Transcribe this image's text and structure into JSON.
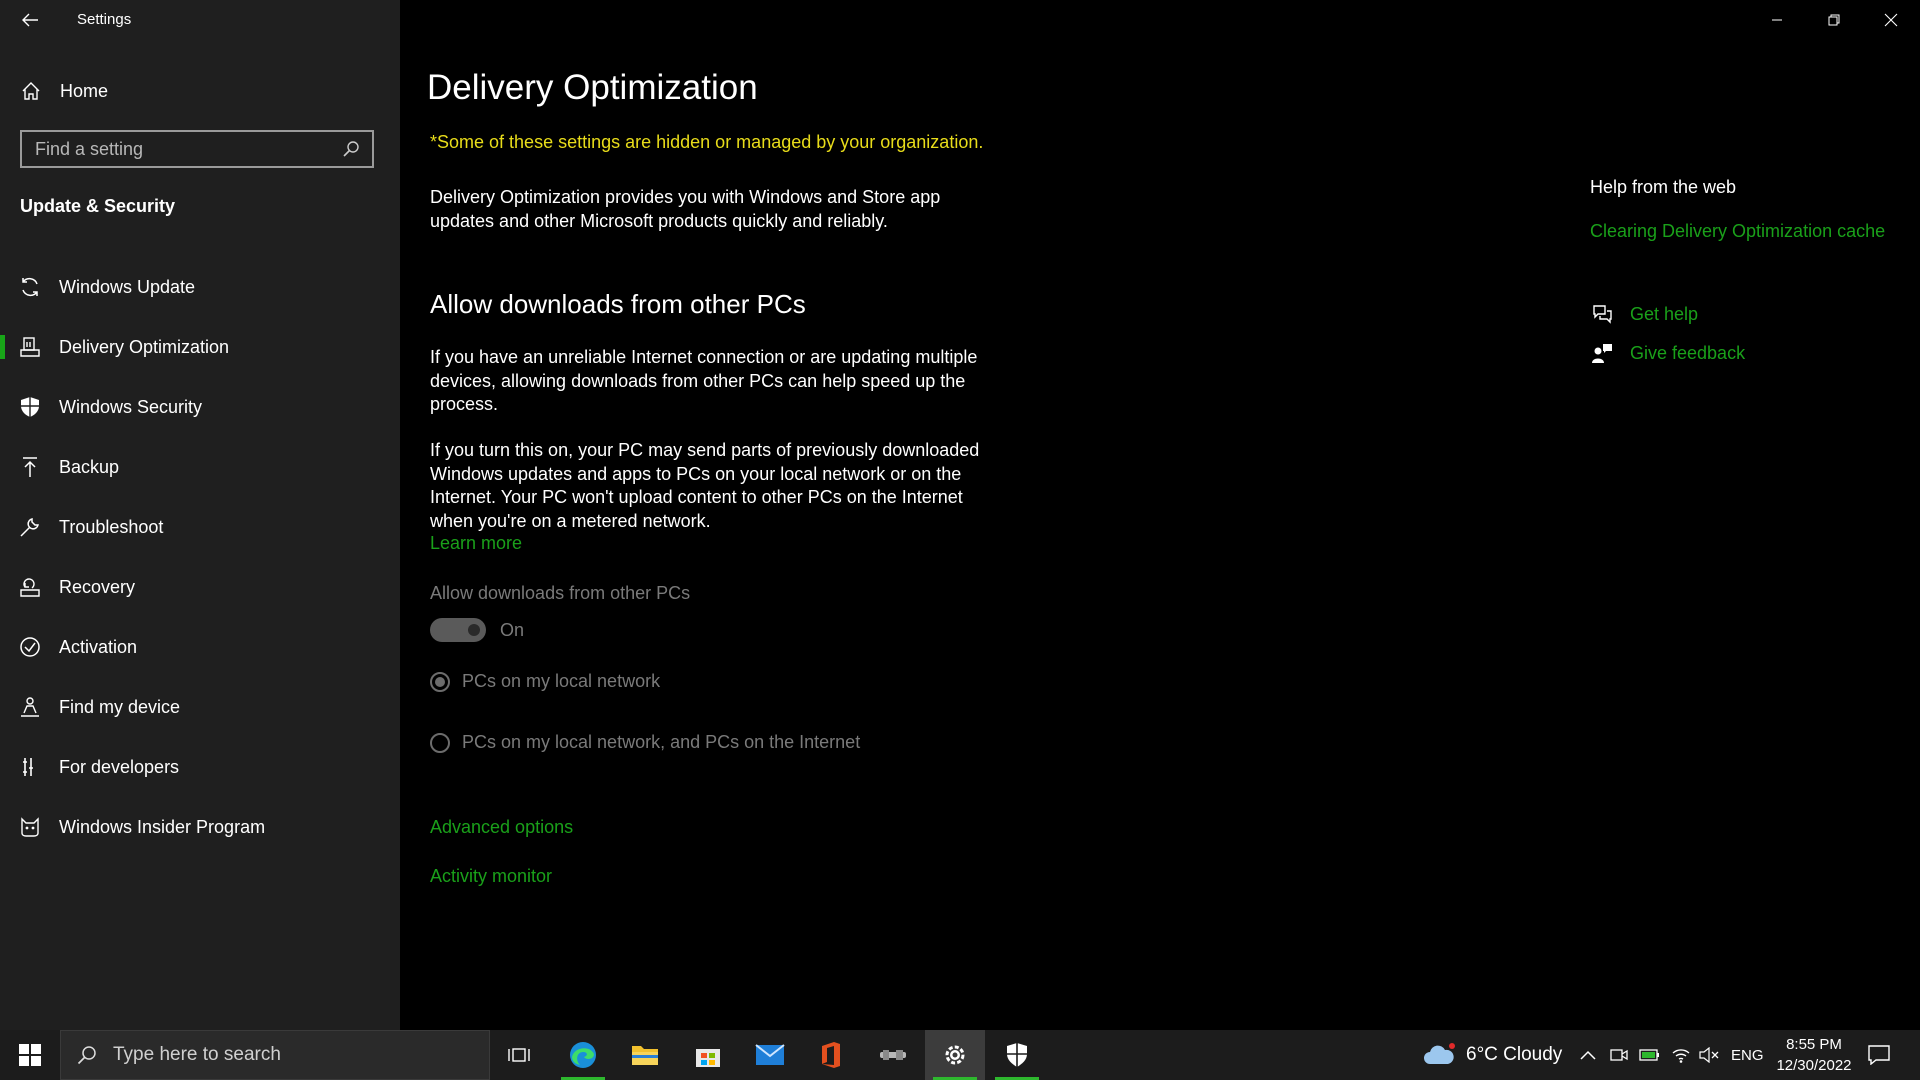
{
  "app": {
    "title": "Settings"
  },
  "sidebar": {
    "home_label": "Home",
    "search_placeholder": "Find a setting",
    "section_title": "Update & Security",
    "items": [
      {
        "label": "Windows Update",
        "icon": "refresh-icon"
      },
      {
        "label": "Delivery Optimization",
        "icon": "delivery-icon",
        "active": true
      },
      {
        "label": "Windows Security",
        "icon": "shield-icon"
      },
      {
        "label": "Backup",
        "icon": "upload-arrow-icon"
      },
      {
        "label": "Troubleshoot",
        "icon": "wrench-icon"
      },
      {
        "label": "Recovery",
        "icon": "recovery-icon"
      },
      {
        "label": "Activation",
        "icon": "check-circle-icon"
      },
      {
        "label": "Find my device",
        "icon": "person-location-icon"
      },
      {
        "label": "For developers",
        "icon": "developer-tools-icon"
      },
      {
        "label": "Windows Insider Program",
        "icon": "insider-cat-icon"
      }
    ]
  },
  "main": {
    "title": "Delivery Optimization",
    "warning": "*Some of these settings are hidden or managed by your organization.",
    "intro_line1": "Delivery Optimization provides you with Windows and Store app",
    "intro_line2": "updates and other Microsoft products quickly and reliably.",
    "section_heading": "Allow downloads from other PCs",
    "para1_line1": "If you have an unreliable Internet connection or are updating multiple",
    "para1_line2": "devices, allowing downloads from other PCs can help speed up the",
    "para1_line3": "process.",
    "para2_line1": "If you turn this on, your PC may send parts of previously downloaded",
    "para2_line2": "Windows updates and apps to PCs on your local network or on the",
    "para2_line3": "Internet. Your PC won't upload content to other PCs on the Internet",
    "para2_line4": "when you're on a metered network.",
    "learn_more": "Learn more",
    "toggle_label": "Allow downloads from other PCs",
    "toggle_state": "On",
    "toggle_on": true,
    "radio_options": [
      {
        "label": "PCs on my local network",
        "checked": true
      },
      {
        "label": "PCs on my local network, and PCs on the Internet",
        "checked": false
      }
    ],
    "advanced_options": "Advanced options",
    "activity_monitor": "Activity monitor"
  },
  "help": {
    "title": "Help from the web",
    "web_link": "Clearing Delivery Optimization cache",
    "get_help": "Get help",
    "give_feedback": "Give feedback"
  },
  "taskbar": {
    "search_placeholder": "Type here to search",
    "apps": [
      "task-view-icon",
      "edge-icon",
      "file-explorer-icon",
      "store-icon",
      "mail-icon",
      "office-icon",
      "game-app-icon",
      "settings-gear-icon",
      "windows-security-icon"
    ],
    "weather": "6°C  Cloudy",
    "language": "ENG",
    "time": "8:55 PM",
    "date": "12/30/2022"
  },
  "colors": {
    "accent_green": "#1aa01a",
    "warning_yellow": "#e8dc1a",
    "sidebar_bg": "#1f1f1f",
    "main_bg": "#000000"
  }
}
